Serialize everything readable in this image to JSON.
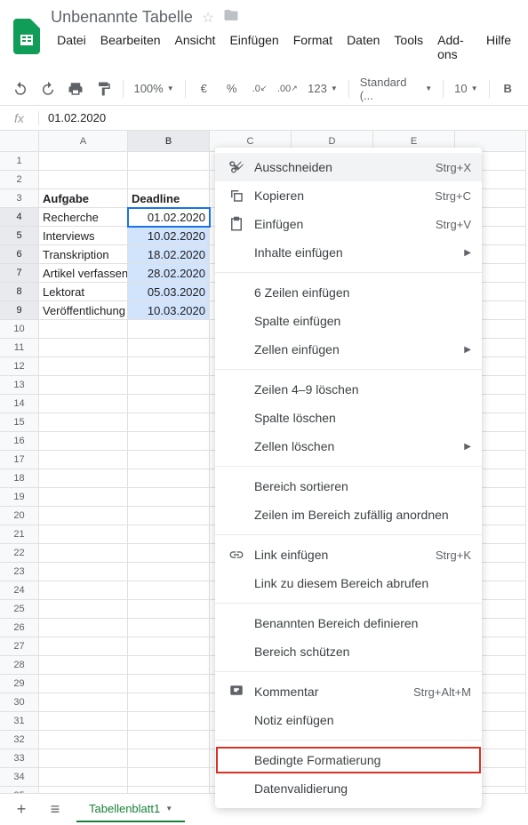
{
  "header": {
    "title": "Unbenannte Tabelle",
    "menu": [
      "Datei",
      "Bearbeiten",
      "Ansicht",
      "Einfügen",
      "Format",
      "Daten",
      "Tools",
      "Add-ons",
      "Hilfe"
    ]
  },
  "toolbar": {
    "zoom": "100%",
    "currency": "€",
    "percent": "%",
    "dec_less": ".0",
    "dec_more": ".00",
    "format_num": "123",
    "font": "Standard (...",
    "size": "10",
    "bold": "B"
  },
  "formula": {
    "fx": "fx",
    "value": "01.02.2020"
  },
  "columns": [
    "A",
    "B",
    "C",
    "D",
    "E",
    ""
  ],
  "rows_count": 35,
  "data": {
    "r3": {
      "A": "Aufgabe",
      "B": "Deadline"
    },
    "r4": {
      "A": "Recherche",
      "B": "01.02.2020"
    },
    "r5": {
      "A": "Interviews",
      "B": "10.02.2020"
    },
    "r6": {
      "A": "Transkription",
      "B": "18.02.2020"
    },
    "r7": {
      "A": "Artikel verfassen",
      "B": "28.02.2020"
    },
    "r8": {
      "A": "Lektorat",
      "B": "05.03.2020"
    },
    "r9": {
      "A": "Veröffentlichung",
      "B": "10.03.2020"
    }
  },
  "context_menu": [
    {
      "icon": "cut",
      "label": "Ausschneiden",
      "shortcut": "Strg+X",
      "hover": true
    },
    {
      "icon": "copy",
      "label": "Kopieren",
      "shortcut": "Strg+C"
    },
    {
      "icon": "paste",
      "label": "Einfügen",
      "shortcut": "Strg+V"
    },
    {
      "label": "Inhalte einfügen",
      "arrow": true
    },
    {
      "sep": true
    },
    {
      "label": "6 Zeilen einfügen"
    },
    {
      "label": "Spalte einfügen"
    },
    {
      "label": "Zellen einfügen",
      "arrow": true
    },
    {
      "sep": true
    },
    {
      "label": "Zeilen 4–9 löschen"
    },
    {
      "label": "Spalte löschen"
    },
    {
      "label": "Zellen löschen",
      "arrow": true
    },
    {
      "sep": true
    },
    {
      "label": "Bereich sortieren"
    },
    {
      "label": "Zeilen im Bereich zufällig anordnen"
    },
    {
      "sep": true
    },
    {
      "icon": "link",
      "label": "Link einfügen",
      "shortcut": "Strg+K"
    },
    {
      "label": "Link zu diesem Bereich abrufen"
    },
    {
      "sep": true
    },
    {
      "label": "Benannten Bereich definieren"
    },
    {
      "label": "Bereich schützen"
    },
    {
      "sep": true
    },
    {
      "icon": "comment",
      "label": "Kommentar",
      "shortcut": "Strg+Alt+M"
    },
    {
      "label": "Notiz einfügen"
    },
    {
      "sep": true
    },
    {
      "label": "Bedingte Formatierung",
      "highlighted": true
    },
    {
      "label": "Datenvalidierung"
    }
  ],
  "tabs": {
    "sheet": "Tabellenblatt1"
  }
}
